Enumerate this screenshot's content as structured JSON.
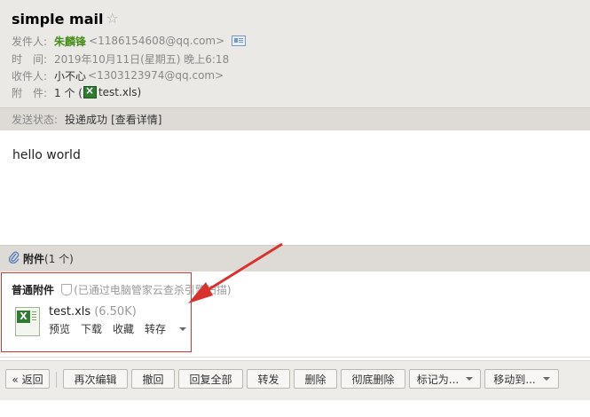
{
  "header": {
    "subject": "simple mail",
    "star_glyph": "☆",
    "sender_label": "发件人:",
    "sender_name": "朱麟锋",
    "sender_email": "<1186154608@qq.com>",
    "time_label": "时　间:",
    "time_value": "2019年10月11日(星期五) 晚上6:18",
    "recipient_label": "收件人:",
    "recipient_name": "小不心",
    "recipient_email": "<1303123974@qq.com>",
    "attachment_label": "附　件:",
    "attachment_count": "1 个 (",
    "attachment_file": "test.xls",
    "attachment_close": ")"
  },
  "status": {
    "label": "发送状态:",
    "value": "投递成功",
    "detail_link": "[查看详情]"
  },
  "body": {
    "text": "hello world"
  },
  "attachments": {
    "title": "附件",
    "count": "(1 个)",
    "section_title": "普通附件",
    "scan_note": "(已通过电脑管家云查杀引擎扫描)",
    "file": {
      "name": "test.xls",
      "size": "(6.50K)",
      "actions": [
        "预览",
        "下载",
        "收藏",
        "转存"
      ]
    }
  },
  "toolbar": {
    "back": "« 返回",
    "reedit": "再次编辑",
    "revoke": "撤回",
    "reply_all": "回复全部",
    "forward": "转发",
    "delete": "删除",
    "delete_perm": "彻底删除",
    "mark_as": "标记为...",
    "move_to": "移动到..."
  },
  "colors": {
    "sender_green": "#4a8f1b",
    "annotation_red": "#d8322f",
    "excel_green": "#2f7b32"
  }
}
